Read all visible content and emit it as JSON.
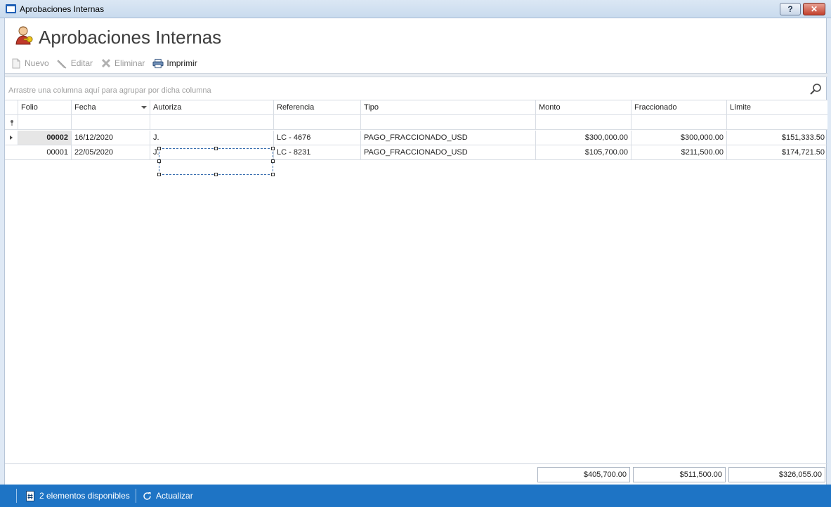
{
  "window": {
    "title": "Aprobaciones Internas",
    "help_label": "?",
    "close_label": "✕"
  },
  "header": {
    "title": "Aprobaciones Internas"
  },
  "toolbar": {
    "nuevo": "Nuevo",
    "editar": "Editar",
    "eliminar": "Eliminar",
    "imprimir": "Imprimir"
  },
  "grid": {
    "group_placeholder": "Arrastre una columna aquí para agrupar por dicha columna",
    "columns": {
      "folio": "Folio",
      "fecha": "Fecha",
      "autoriza": "Autoriza",
      "referencia": "Referencia",
      "tipo": "Tipo",
      "monto": "Monto",
      "fraccionado": "Fraccionado",
      "limite": "Límite"
    },
    "rows": [
      {
        "folio": "00002",
        "fecha": "16/12/2020",
        "autoriza": "J.",
        "referencia": "LC - 4676",
        "tipo": "PAGO_FRACCIONADO_USD",
        "monto": "$300,000.00",
        "fraccionado": "$300,000.00",
        "limite": "$151,333.50"
      },
      {
        "folio": "00001",
        "fecha": "22/05/2020",
        "autoriza": "J.",
        "referencia": "LC - 8231",
        "tipo": "PAGO_FRACCIONADO_USD",
        "monto": "$105,700.00",
        "fraccionado": "$211,500.00",
        "limite": "$174,721.50"
      }
    ],
    "totals": {
      "monto": "$405,700.00",
      "fraccionado": "$511,500.00",
      "limite": "$326,055.00"
    }
  },
  "status": {
    "count_label": "2 elementos disponibles",
    "refresh_label": "Actualizar"
  },
  "colors": {
    "statusbar": "#1e74c5",
    "accent": "#1f5fb5"
  }
}
